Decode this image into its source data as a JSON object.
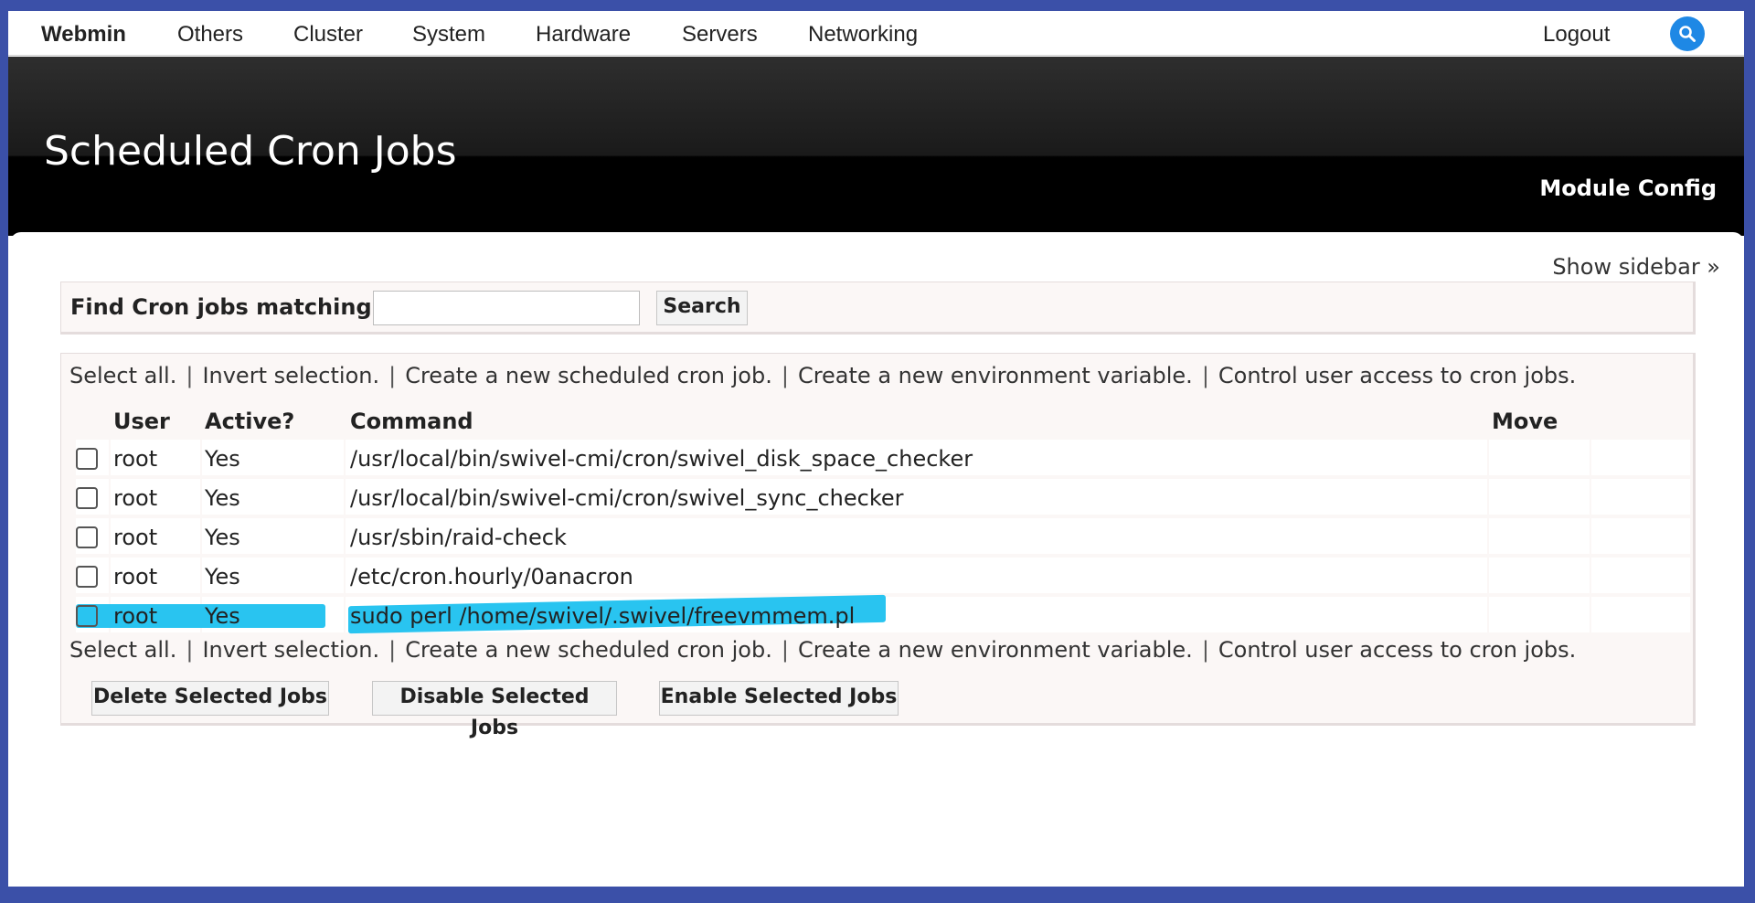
{
  "nav": {
    "brand": "Webmin",
    "items": [
      "Others",
      "Cluster",
      "System",
      "Hardware",
      "Servers",
      "Networking"
    ],
    "logout": "Logout"
  },
  "header": {
    "title": "Scheduled Cron Jobs",
    "module_config": "Module Config"
  },
  "show_sidebar": "Show sidebar »",
  "find": {
    "label": "Find Cron jobs matching",
    "value": "",
    "search_button": "Search"
  },
  "links": {
    "select_all": "Select all.",
    "invert": "Invert selection.",
    "create_job": "Create a new scheduled cron job.",
    "create_env": "Create a new environment variable.",
    "control_access": "Control user access to cron jobs.",
    "separator": "|"
  },
  "table": {
    "headers": {
      "user": "User",
      "active": "Active?",
      "command": "Command",
      "move": "Move"
    },
    "rows": [
      {
        "user": "root",
        "active": "Yes",
        "command": "/usr/local/bin/swivel-cmi/cron/swivel_disk_space_checker",
        "checked": false,
        "highlighted": false
      },
      {
        "user": "root",
        "active": "Yes",
        "command": "/usr/local/bin/swivel-cmi/cron/swivel_sync_checker",
        "checked": false,
        "highlighted": false
      },
      {
        "user": "root",
        "active": "Yes",
        "command": "/usr/sbin/raid-check",
        "checked": false,
        "highlighted": false
      },
      {
        "user": "root",
        "active": "Yes",
        "command": "/etc/cron.hourly/0anacron",
        "checked": false,
        "highlighted": false
      },
      {
        "user": "root",
        "active": "Yes",
        "command": "sudo perl /home/swivel/.swivel/freevmmem.pl",
        "checked": false,
        "highlighted": true
      }
    ]
  },
  "actions": {
    "delete": "Delete Selected Jobs",
    "disable": "Disable Selected Jobs",
    "enable": "Enable Selected Jobs"
  },
  "colors": {
    "highlight": "#29c4f0",
    "background": "#3b50a8",
    "search_icon_bg": "#1e88e5"
  },
  "icons": {
    "search": "search-icon"
  }
}
